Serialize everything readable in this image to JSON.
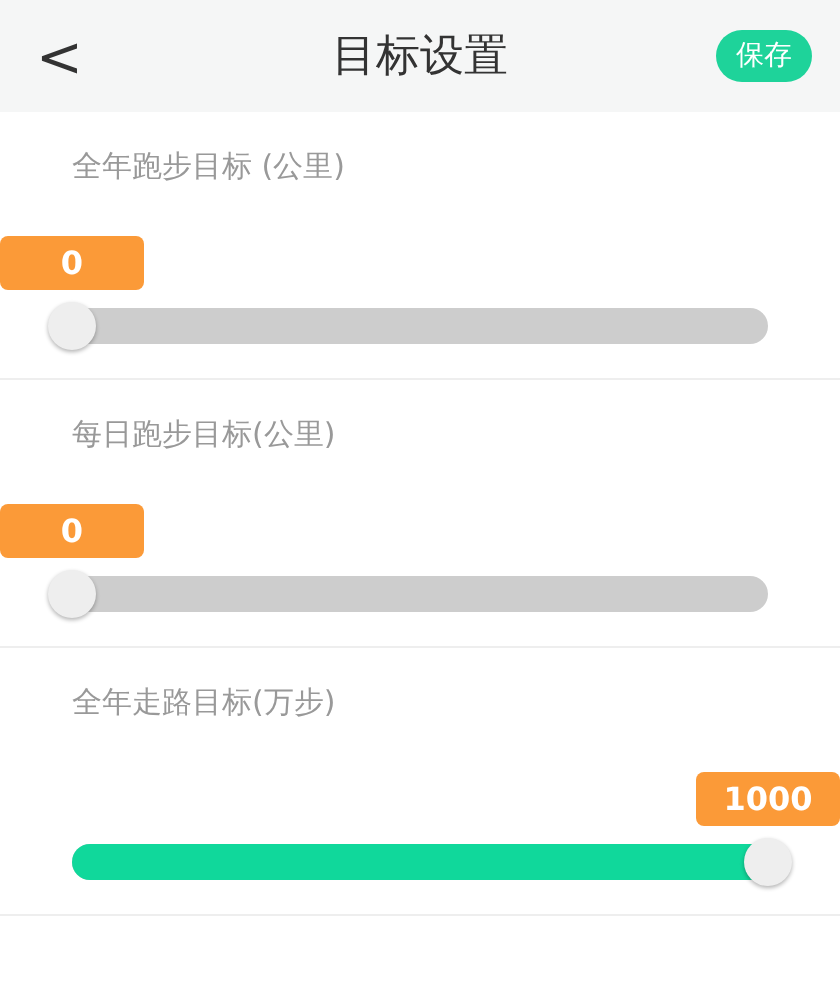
{
  "header": {
    "back": "<",
    "title": "目标设置",
    "save": "保存"
  },
  "goals": [
    {
      "label": "全年跑步目标 (公里)",
      "value": "0",
      "level": 0
    },
    {
      "label": "每日跑步目标(公里)",
      "value": "0",
      "level": 0
    },
    {
      "label": "全年走路目标(万步)",
      "value": "1000",
      "level": 1
    }
  ]
}
